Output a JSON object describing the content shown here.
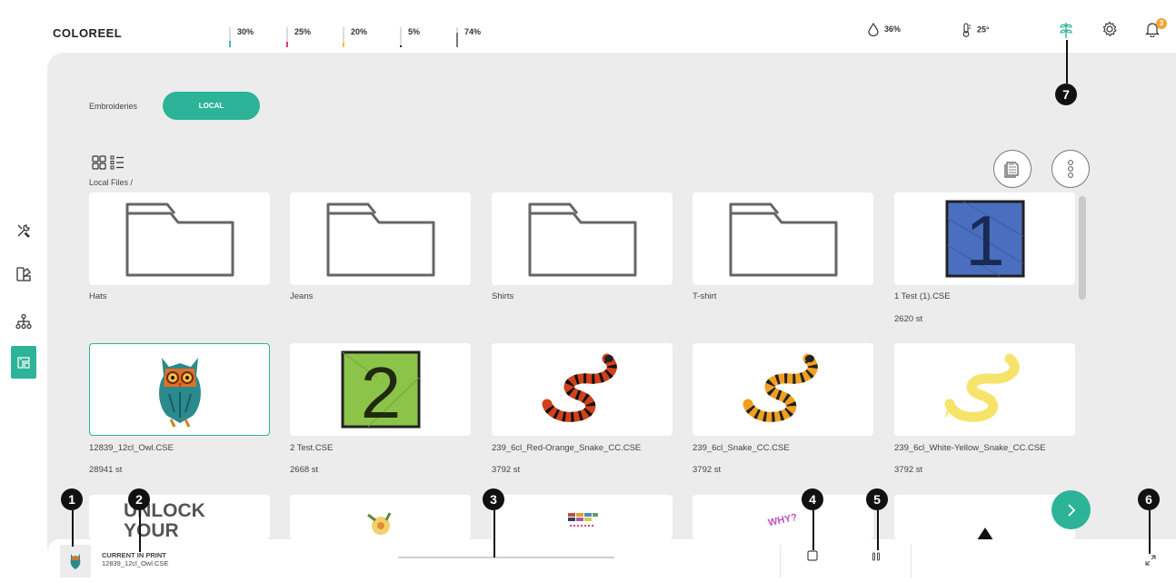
{
  "app": {
    "logo": "COLOREEL"
  },
  "topbar": {
    "inks": [
      {
        "label": "30%",
        "level": 0.3,
        "color": "#3fb8c9"
      },
      {
        "label": "25%",
        "level": 0.25,
        "color": "#d63a8b"
      },
      {
        "label": "20%",
        "level": 0.2,
        "color": "#f2c230"
      },
      {
        "label": "5%",
        "level": 0.05,
        "color": "#222222"
      },
      {
        "label": "74%",
        "level": 0.74,
        "color": "#777777"
      }
    ],
    "humidity": {
      "icon": "droplet-icon",
      "value": "36%"
    },
    "temperature": {
      "icon": "thermometer-icon",
      "value": "25°"
    },
    "notification_count": "3"
  },
  "sidebar": {
    "items": [
      {
        "name": "tools",
        "icon": "tools-icon"
      },
      {
        "name": "color",
        "icon": "palette-icon"
      },
      {
        "name": "network",
        "icon": "network-icon"
      },
      {
        "name": "embroidery",
        "icon": "embroidery-machine-icon",
        "active": true
      }
    ]
  },
  "breadcrumb": {
    "root": "Embroideries",
    "tab": "LOCAL"
  },
  "path": "Local Files /",
  "files": [
    {
      "name": "Hats",
      "type": "folder",
      "stitches": ""
    },
    {
      "name": "Jeans",
      "type": "folder",
      "stitches": ""
    },
    {
      "name": "Shirts",
      "type": "folder",
      "stitches": ""
    },
    {
      "name": "T-shirt",
      "type": "folder",
      "stitches": ""
    },
    {
      "name": "1 Test (1).CSE",
      "type": "test1",
      "stitches": "2620 st"
    },
    {
      "name": "12839_12cl_Owl.CSE",
      "type": "owl",
      "stitches": "28941 st",
      "selected": true
    },
    {
      "name": "2 Test.CSE",
      "type": "test2",
      "stitches": "2668 st"
    },
    {
      "name": "239_6cl_Red-Orange_Snake_CC.CSE",
      "type": "snake-red",
      "stitches": "3792 st"
    },
    {
      "name": "239_6cl_Snake_CC.CSE",
      "type": "snake-orange",
      "stitches": "3792 st"
    },
    {
      "name": "239_6cl_White-Yellow_Snake_CC.CSE",
      "type": "snake-yellow",
      "stitches": "3792 st"
    }
  ],
  "partial_row": {
    "unlock_text_1": "UNLOCK",
    "unlock_text_2": "YOUR",
    "why_text": "WHY?"
  },
  "bottombar": {
    "label": "CURRENT IN PRINT",
    "file": "12839_12cl_Owl.CSE",
    "progress": 0.0
  },
  "callouts": [
    "1",
    "2",
    "3",
    "4",
    "5",
    "6",
    "7"
  ],
  "colors": {
    "accent": "#2db397",
    "background": "#ececec"
  }
}
